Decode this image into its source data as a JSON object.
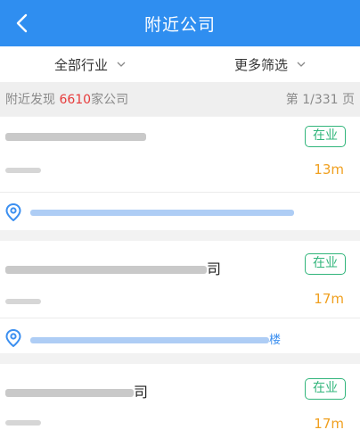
{
  "header": {
    "title": "附近公司"
  },
  "filters": {
    "industry": "全部行业",
    "more": "更多筛选"
  },
  "summary": {
    "prefix": "附近发现 ",
    "count": "6610",
    "suffix": "家公司",
    "page": "第 1/331 页"
  },
  "companies": [
    {
      "name_tail": "",
      "status": "在业",
      "distance": "13m",
      "address_tail": ""
    },
    {
      "name_tail": "司",
      "status": "在业",
      "distance": "17m",
      "address_tail": "楼"
    },
    {
      "name_tail": "司",
      "status": "在业",
      "distance": "17m",
      "address_tail": ""
    }
  ],
  "colors": {
    "brand": "#2f8ef0",
    "status": "#31b57b",
    "distance": "#f0a020",
    "count": "#e63b3b"
  }
}
